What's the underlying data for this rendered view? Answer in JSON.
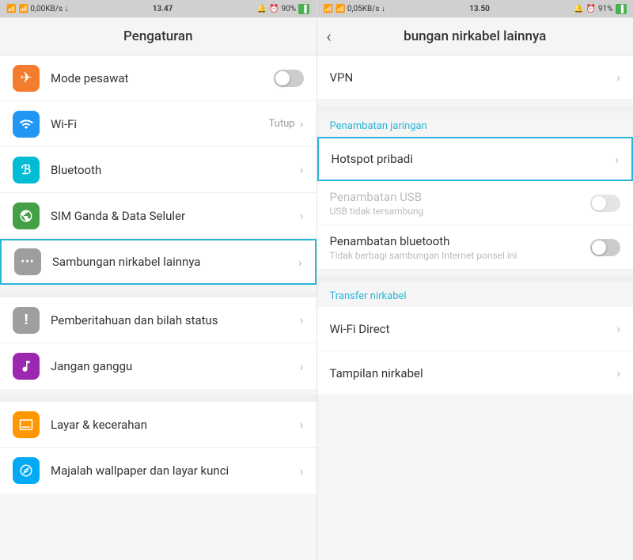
{
  "left_panel": {
    "status_bar": {
      "left": "📶 0,00KB/s ↓",
      "time": "13.47",
      "right": "🔔 ⏰ 90%"
    },
    "title": "Pengaturan",
    "items": [
      {
        "id": "mode-pesawat",
        "label": "Mode pesawat",
        "icon": "✈",
        "icon_color": "orange",
        "right_type": "toggle",
        "toggle_on": false
      },
      {
        "id": "wifi",
        "label": "Wi-Fi",
        "icon": "📶",
        "icon_color": "blue",
        "right_type": "text_chevron",
        "right_text": "Tutup"
      },
      {
        "id": "bluetooth",
        "label": "Bluetooth",
        "icon": "🔵",
        "icon_color": "teal",
        "right_type": "chevron",
        "right_text": ""
      },
      {
        "id": "sim-data",
        "label": "SIM Ganda & Data Seluler",
        "icon": "🌐",
        "icon_color": "green",
        "right_type": "chevron",
        "right_text": ""
      },
      {
        "id": "sambungan-nirkabel",
        "label": "Sambungan nirkabel lainnya",
        "icon": "···",
        "icon_color": "gray",
        "right_type": "chevron",
        "highlighted": true
      }
    ],
    "items2": [
      {
        "id": "pemberitahuan",
        "label": "Pemberitahuan dan bilah status",
        "icon": "!",
        "icon_color": "gray",
        "right_type": "chevron"
      },
      {
        "id": "jangan-ganggu",
        "label": "Jangan ganggu",
        "icon": "🎵",
        "icon_color": "purple",
        "right_type": "chevron"
      }
    ],
    "items3": [
      {
        "id": "layar-kecerahan",
        "label": "Layar &  kecerahan",
        "icon": "🖥",
        "icon_color": "amber",
        "right_type": "chevron"
      },
      {
        "id": "majalah-wallpaper",
        "label": "Majalah wallpaper dan layar kunci",
        "icon": "✿",
        "icon_color": "light-blue",
        "right_type": "chevron"
      }
    ]
  },
  "right_panel": {
    "status_bar": {
      "left": "📶 0,05KB/s ↓",
      "time": "13.50",
      "right": "🔔 ⏰ 91%"
    },
    "title": "bungan nirkabel lainnya",
    "sections": [
      {
        "items": [
          {
            "id": "vpn",
            "label": "VPN",
            "right_type": "chevron"
          }
        ]
      },
      {
        "section_label": "Penambatan jaringan",
        "items": [
          {
            "id": "hotspot-pribadi",
            "label": "Hotspot pribadi",
            "right_type": "chevron",
            "highlighted": true
          },
          {
            "id": "penambatan-usb",
            "label": "Penambatan USB",
            "sublabel": "USB tidak tersambung",
            "right_type": "toggle",
            "toggle_on": false,
            "disabled": true
          },
          {
            "id": "penambatan-bluetooth",
            "label": "Penambatan bluetooth",
            "sublabel": "Tidak berbagi sambungan Internet ponsel ini",
            "right_type": "toggle",
            "toggle_on": false
          }
        ]
      },
      {
        "section_label": "Transfer nirkabel",
        "items": [
          {
            "id": "wifi-direct",
            "label": "Wi-Fi Direct",
            "right_type": "chevron"
          },
          {
            "id": "tampilan-nirkabel",
            "label": "Tampilan nirkabel",
            "right_type": "chevron"
          }
        ]
      }
    ]
  }
}
